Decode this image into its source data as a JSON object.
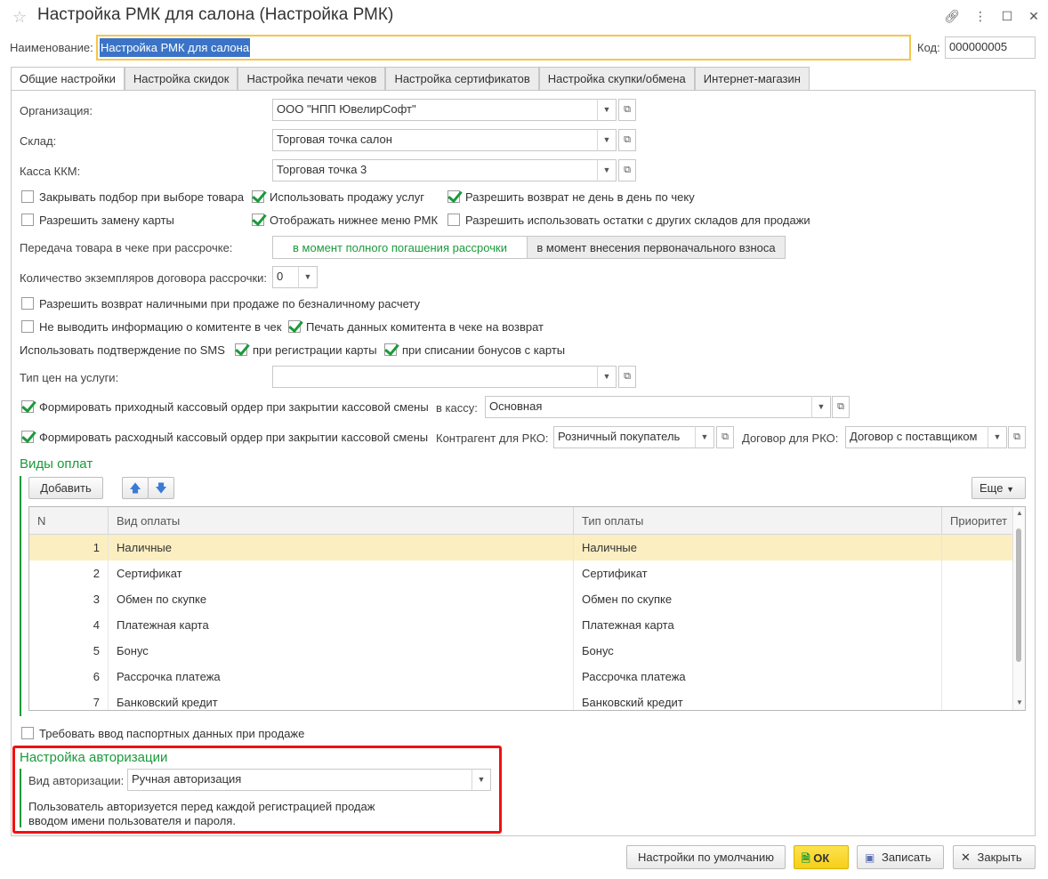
{
  "window": {
    "title": "Настройка РМК для салона (Настройка РМК)"
  },
  "header": {
    "name_label": "Наименование:",
    "name_value": "Настройка РМК для салона",
    "code_label": "Код:",
    "code_value": "000000005"
  },
  "tabs": [
    {
      "label": "Общие настройки",
      "active": true
    },
    {
      "label": "Настройка скидок",
      "active": false
    },
    {
      "label": "Настройка печати чеков",
      "active": false
    },
    {
      "label": "Настройка сертификатов",
      "active": false
    },
    {
      "label": "Настройка скупки/обмена",
      "active": false
    },
    {
      "label": "Интернет-магазин",
      "active": false
    }
  ],
  "general": {
    "org_label": "Организация:",
    "org_value": "ООО \"НПП ЮвелирСофт\"",
    "warehouse_label": "Склад:",
    "warehouse_value": "Торговая точка салон",
    "kkm_label": "Касса ККМ:",
    "kkm_value": "Торговая точка 3",
    "checkboxes": {
      "close_selection": {
        "label": "Закрывать подбор при выборе товара",
        "checked": false
      },
      "use_services": {
        "label": "Использовать продажу услуг",
        "checked": true
      },
      "allow_return_not_same_day": {
        "label": "Разрешить возврат не день в день по чеку",
        "checked": true
      },
      "allow_card_replace": {
        "label": "Разрешить замену карты",
        "checked": false
      },
      "show_bottom_menu": {
        "label": "Отображать нижнее меню РМК",
        "checked": true
      },
      "allow_other_warehouses": {
        "label": "Разрешить использовать остатки с других складов для продажи",
        "checked": false
      },
      "allow_cash_return": {
        "label": "Разрешить возврат наличными при продаже по безналичному расчету",
        "checked": false
      },
      "no_committent_info": {
        "label": "Не выводить информацию о комитенте в чек",
        "checked": false
      },
      "print_committent_return": {
        "label": "Печать данных комитента в чеке на возврат",
        "checked": true
      },
      "sms_card_reg": {
        "label": "при регистрации карты",
        "checked": true
      },
      "sms_bonus": {
        "label": "при списании бонусов с карты",
        "checked": true
      },
      "income_order": {
        "label": "Формировать приходный кассовый ордер при закрытии кассовой смены",
        "checked": true
      },
      "expense_order": {
        "label": "Формировать расходный кассовый ордер при закрытии кассовой смены",
        "checked": true
      },
      "passport_required": {
        "label": "Требовать ввод паспортных данных при продаже",
        "checked": false
      }
    },
    "installment_label": "Передача товара в чеке при рассрочке:",
    "installment_options": [
      "в момент полного погашения рассрочки",
      "в момент внесения первоначального взноса"
    ],
    "installment_selected": "в момент полного погашения рассрочки",
    "copies_label": "Количество экземпляров договора рассрочки:",
    "copies_value": "0",
    "sms_label": "Использовать подтверждение по SMS",
    "service_price_label": "Тип цен на услуги:",
    "service_price_value": "",
    "to_cashbox_label": "в кассу:",
    "to_cashbox_value": "Основная",
    "contractor_label": "Контрагент для РКО:",
    "contractor_value": "Розничный покупатель",
    "contract_label": "Договор для РКО:",
    "contract_value": "Договор с поставщиком"
  },
  "payments": {
    "section_title": "Виды оплат",
    "add_label": "Добавить",
    "more_label": "Еще",
    "columns": [
      "N",
      "Вид оплаты",
      "Тип оплаты",
      "Приоритет"
    ],
    "rows": [
      {
        "n": "1",
        "kind": "Наличные",
        "type": "Наличные",
        "priority": ""
      },
      {
        "n": "2",
        "kind": "Сертификат",
        "type": "Сертификат",
        "priority": ""
      },
      {
        "n": "3",
        "kind": "Обмен по скупке",
        "type": "Обмен по скупке",
        "priority": ""
      },
      {
        "n": "4",
        "kind": "Платежная карта",
        "type": "Платежная карта",
        "priority": ""
      },
      {
        "n": "5",
        "kind": "Бонус",
        "type": "Бонус",
        "priority": ""
      },
      {
        "n": "6",
        "kind": "Рассрочка платежа",
        "type": "Рассрочка платежа",
        "priority": ""
      },
      {
        "n": "7",
        "kind": "Банковский кредит",
        "type": "Банковский кредит",
        "priority": ""
      }
    ]
  },
  "auth": {
    "section_title": "Настройка авторизации",
    "kind_label": "Вид авторизации:",
    "kind_value": "Ручная авторизация",
    "hint_line1": "Пользователь авторизуется перед каждой регистрацией продаж",
    "hint_line2": "вводом имени пользователя и пароля."
  },
  "footer": {
    "defaults_label": "Настройки по умолчанию",
    "ok_label": "ОК",
    "save_label": "Записать",
    "close_label": "Закрыть"
  },
  "colors": {
    "accent_green": "#1a9b3a",
    "selection_blue": "#3b74c6",
    "highlight_yellow": "#fbeec1",
    "focus_border": "#f4c64b",
    "callout_red": "#ee1111"
  }
}
